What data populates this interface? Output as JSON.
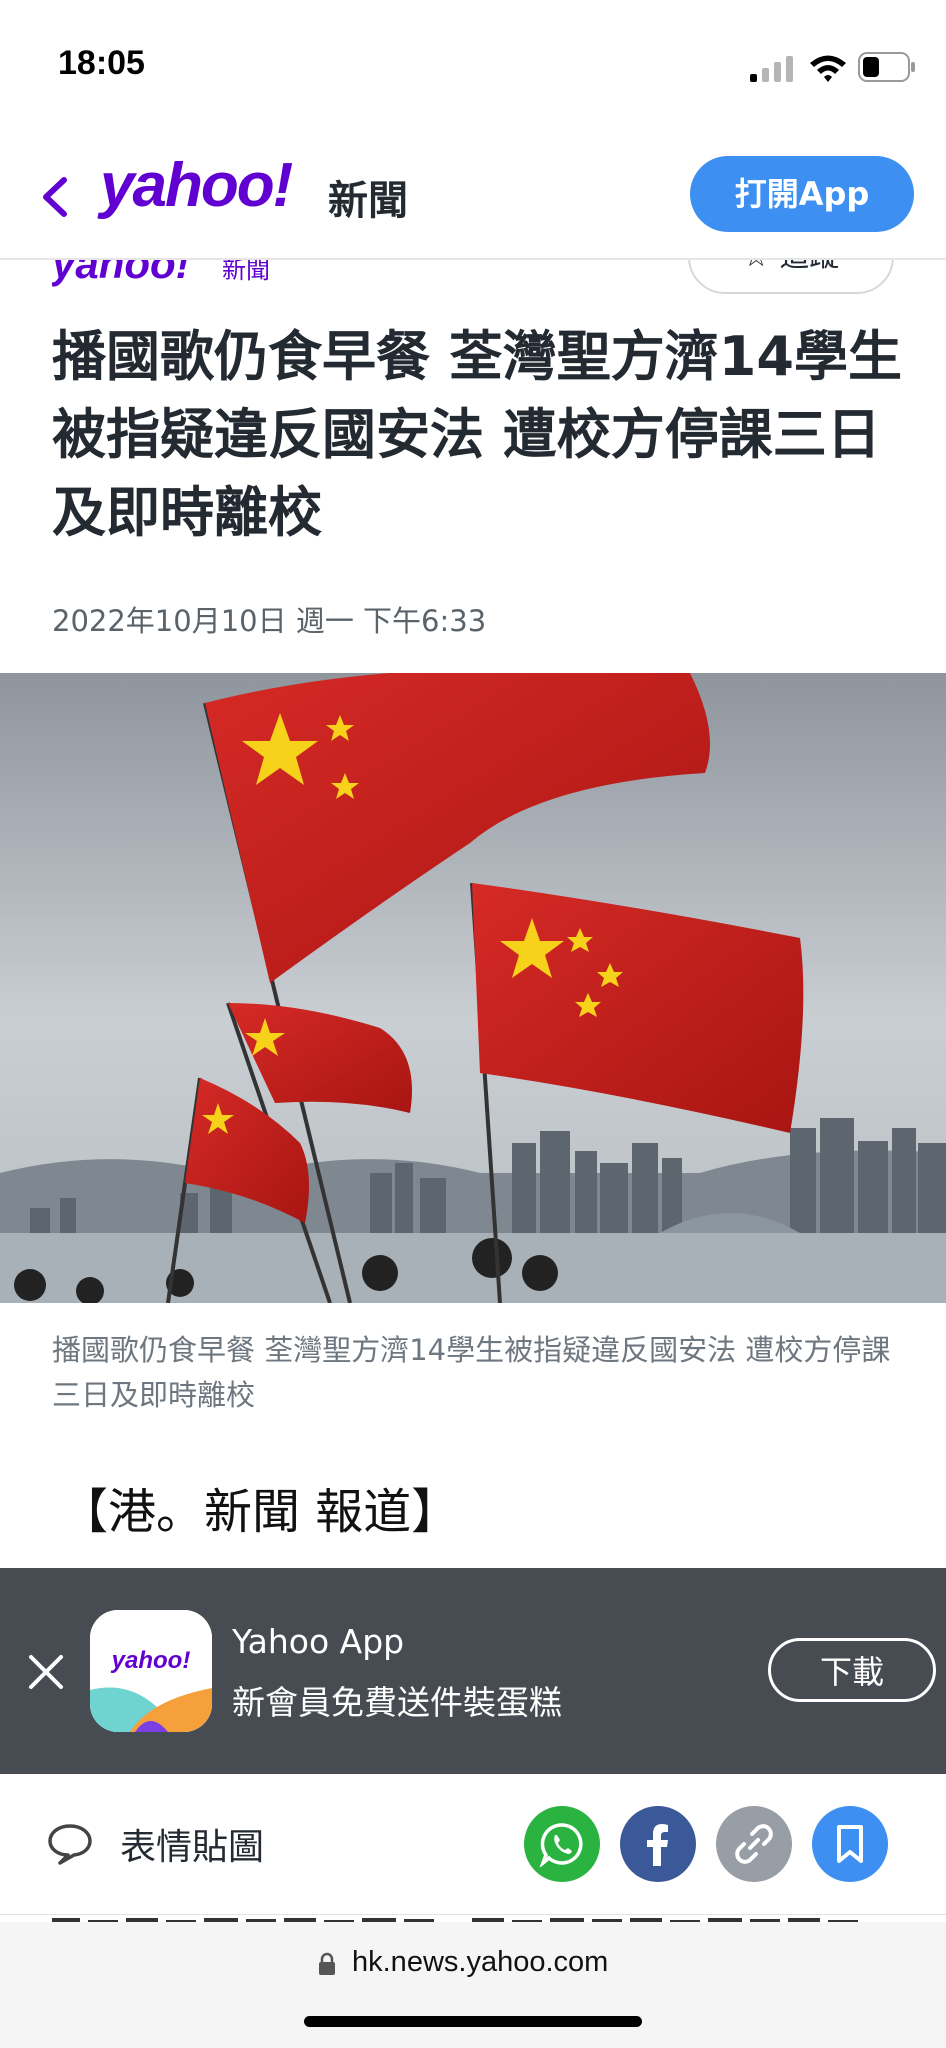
{
  "status_bar": {
    "time": "18:05"
  },
  "nav": {
    "logo": "yahoo!",
    "logo_section": "新聞",
    "open_app": "打開App"
  },
  "sub_header": {
    "logo": "yahoo!",
    "logo_section": "新聞",
    "follow": "☆ 追蹤"
  },
  "article": {
    "headline": "播國歌仍食早餐 荃灣聖方濟14學生被指疑違反國安法 遭校方停課三日及即時離校",
    "date": "2022年10月10日 週一 下午6:33",
    "caption": "播國歌仍食早餐 荃灣聖方濟14學生被指疑違反國安法 遭校方停課三日及即時離校",
    "source": "【港。新聞 報道】"
  },
  "app_banner": {
    "icon_text": "yahoo!",
    "title": "Yahoo App",
    "subtitle": "新會員免費送件裝蛋糕",
    "download": "下載"
  },
  "share_bar": {
    "stickers": "表情貼圖"
  },
  "safari": {
    "url": "hk.news.yahoo.com"
  },
  "colors": {
    "brand_purple": "#6001d2",
    "accent_blue": "#3d8ff2",
    "banner_bg": "#474c52",
    "whatsapp": "#2bb341",
    "facebook": "#3b5998",
    "link": "#979ea5"
  }
}
